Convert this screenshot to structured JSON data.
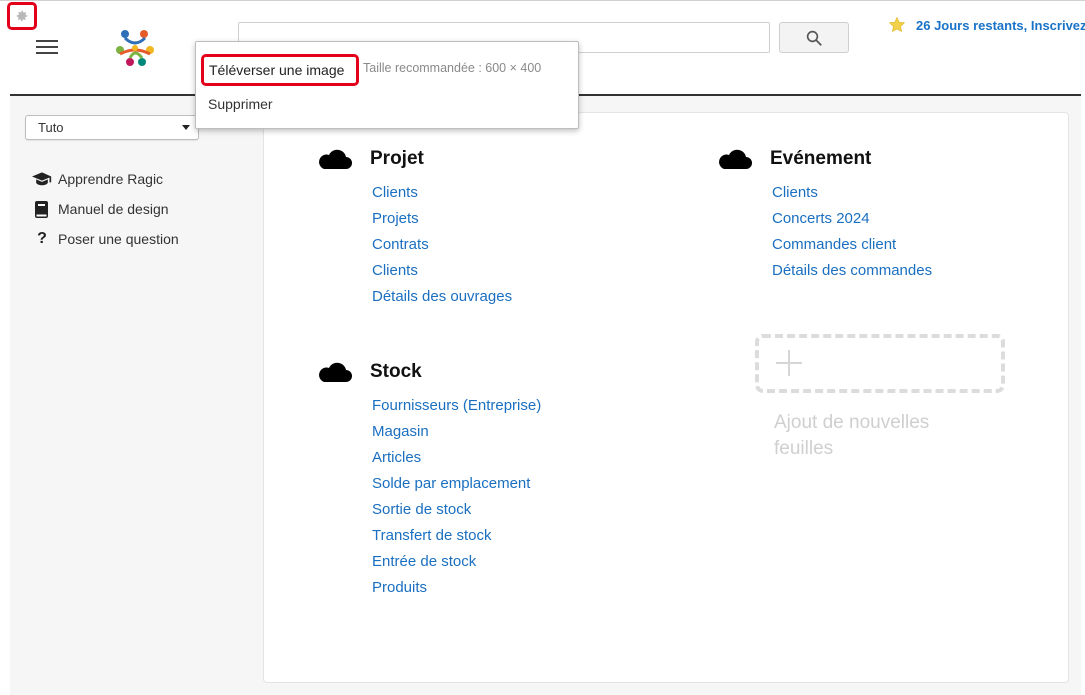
{
  "header": {
    "search_placeholder": "",
    "trial_text": "26 Jours restants, Inscrivez"
  },
  "popover": {
    "upload_label": "Téléverser une image",
    "upload_hint": "Taille recommandée : 600 × 400",
    "delete_label": "Supprimer"
  },
  "sidebar": {
    "select_value": "Tuto",
    "items": [
      {
        "label": "Apprendre Ragic",
        "icon": "graduation-cap-icon"
      },
      {
        "label": "Manuel de design",
        "icon": "book-icon"
      },
      {
        "label": "Poser une question",
        "icon": "question-icon"
      }
    ]
  },
  "groups": [
    {
      "title": "Projet",
      "links": [
        "Clients",
        "Projets",
        "Contrats",
        "Clients",
        "Détails des ouvrages"
      ]
    },
    {
      "title": "Evénement",
      "links": [
        "Clients",
        "Concerts 2024",
        "Commandes client",
        "Détails des commandes"
      ]
    },
    {
      "title": "Stock",
      "links": [
        "Fournisseurs (Entreprise)",
        "Magasin",
        "Articles",
        "Solde par emplacement",
        "Sortie de stock",
        "Transfert de stock",
        "Entrée de stock",
        "Produits"
      ]
    }
  ],
  "add_sheet": {
    "label": "Ajout de nouvelles feuilles"
  },
  "colors": {
    "accent": "#1a6fc0",
    "highlight": "#e3001b",
    "star": "#f3d24b"
  }
}
